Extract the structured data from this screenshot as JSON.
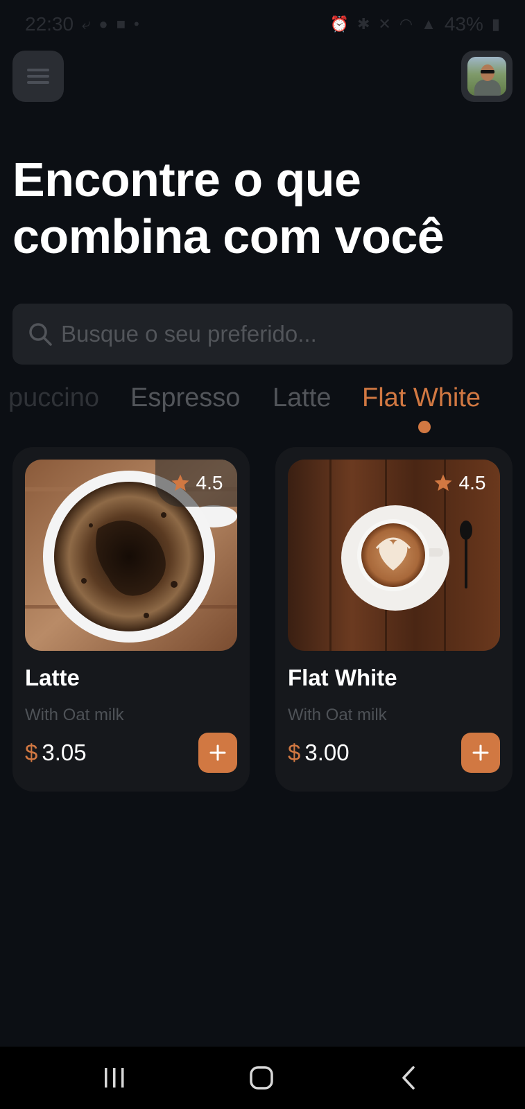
{
  "status_bar": {
    "time": "22:30",
    "left_icons": [
      "missed-call-icon",
      "a-icon",
      "puzzle-icon",
      "dot-icon"
    ],
    "battery": "43%",
    "right_icons": [
      "alarm-icon",
      "bluetooth-icon",
      "mute-icon",
      "wifi-icon",
      "signal-icon",
      "battery-icon"
    ]
  },
  "header": {
    "menu_icon": "hamburger-menu-icon",
    "avatar": "profile-avatar"
  },
  "title": {
    "line1": "Encontre o que",
    "line2": "combina com você"
  },
  "search": {
    "placeholder": "Busque o seu preferido...",
    "value": ""
  },
  "categories": [
    {
      "label": "Cappuccino",
      "visible_text": "puccino",
      "active": false
    },
    {
      "label": "Espresso",
      "active": false
    },
    {
      "label": "Latte",
      "active": false
    },
    {
      "label": "Flat White",
      "active": true
    }
  ],
  "products": [
    {
      "name": "Latte",
      "description": "With Oat milk",
      "currency": "$",
      "price": "3.05",
      "rating": "4.5",
      "image": "black-coffee-cup-top-view"
    },
    {
      "name": "Flat White",
      "description": "With Oat milk",
      "currency": "$",
      "price": "3.00",
      "rating": "4.5",
      "image": "latte-art-cup-on-wooden-table"
    }
  ],
  "colors": {
    "background": "#0c0f14",
    "accent": "#d17842",
    "card": "#16181c",
    "muted_text": "#52555a"
  },
  "nav": {
    "recents": "recents-icon",
    "home": "home-icon",
    "back": "back-icon"
  }
}
